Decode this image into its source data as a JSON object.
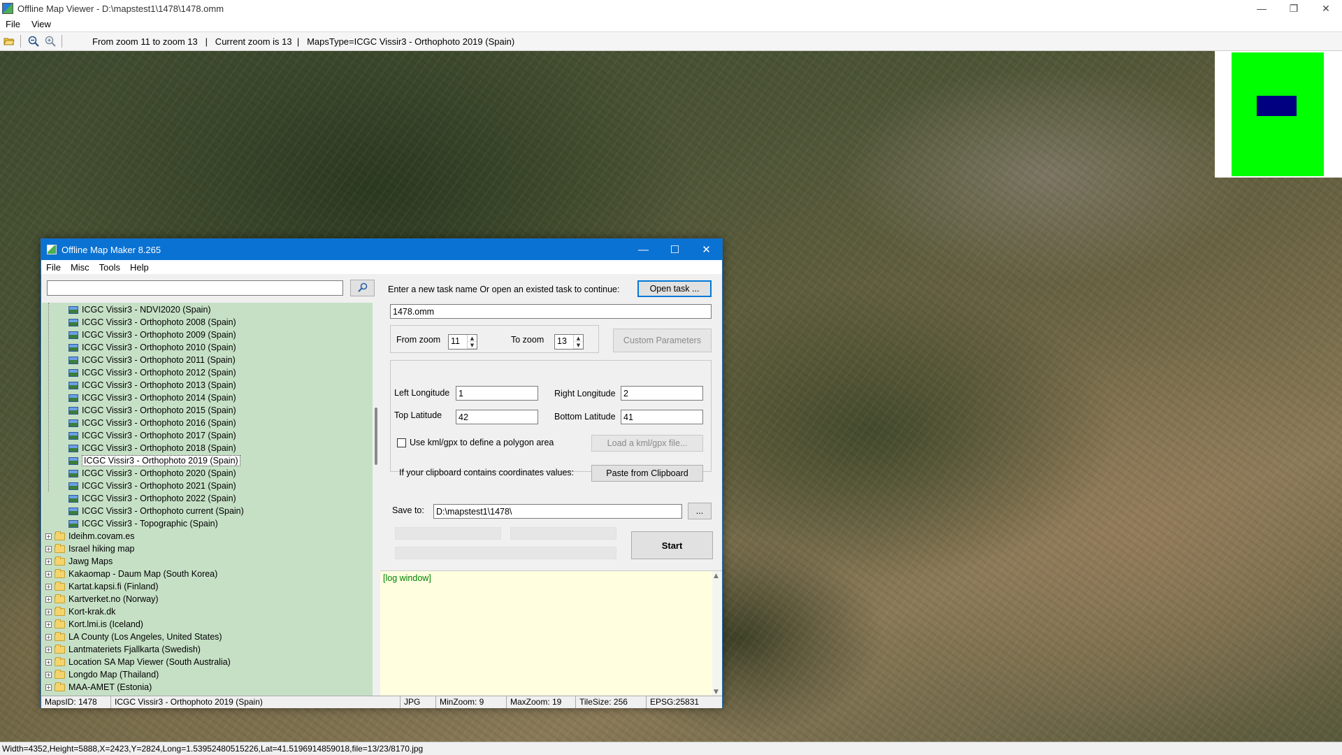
{
  "viewer": {
    "title": "Offline Map Viewer - D:\\mapstest1\\1478\\1478.omm",
    "menu": [
      "File",
      "View"
    ],
    "toolbar_status": "From zoom 11 to zoom 13   |   Current zoom is 13  |   MapsType=ICGC Vissir3 - Orthophoto 2019 (Spain)",
    "statusbar": "Width=4352,Height=5888,X=2423,Y=2824,Long=1.53952480515226,Lat=41.5196914859018,file=13/23/8170.jpg",
    "colors": {
      "minimap_area": "#00ff00",
      "minimap_box": "#000080"
    }
  },
  "dialog": {
    "title": "Offline Map Maker 8.265",
    "menu": [
      "File",
      "Misc",
      "Tools",
      "Help"
    ],
    "search": {
      "value": "",
      "placeholder": ""
    },
    "tree": {
      "children": [
        "ICGC Vissir3 - NDVI2020 (Spain)",
        "ICGC Vissir3 - Orthophoto 2008 (Spain)",
        "ICGC Vissir3 - Orthophoto 2009 (Spain)",
        "ICGC Vissir3 - Orthophoto 2010 (Spain)",
        "ICGC Vissir3 - Orthophoto 2011 (Spain)",
        "ICGC Vissir3 - Orthophoto 2012 (Spain)",
        "ICGC Vissir3 - Orthophoto 2013 (Spain)",
        "ICGC Vissir3 - Orthophoto 2014 (Spain)",
        "ICGC Vissir3 - Orthophoto 2015 (Spain)",
        "ICGC Vissir3 - Orthophoto 2016 (Spain)",
        "ICGC Vissir3 - Orthophoto 2017 (Spain)",
        "ICGC Vissir3 - Orthophoto 2018 (Spain)",
        "ICGC Vissir3 - Orthophoto 2019 (Spain)",
        "ICGC Vissir3 - Orthophoto 2020 (Spain)",
        "ICGC Vissir3 - Orthophoto 2021 (Spain)",
        "ICGC Vissir3 - Orthophoto 2022 (Spain)",
        "ICGC Vissir3 - Orthophoto current (Spain)",
        "ICGC Vissir3 - Topographic (Spain)"
      ],
      "selected": "ICGC Vissir3 - Orthophoto 2019 (Spain)",
      "folders": [
        "Ideihm.covam.es",
        "Israel hiking map",
        "Jawg Maps",
        "Kakaomap - Daum Map (South Korea)",
        "Kartat.kapsi.fi (Finland)",
        "Kartverket.no (Norway)",
        "Kort-krak.dk",
        "Kort.lmi.is (Iceland)",
        "LA County (Los Angeles, United States)",
        "Lantmateriets Fjallkarta (Swedish)",
        "Location SA Map Viewer (South Australia)",
        "Longdo Map (Thailand)",
        "MAA-AMET (Estonia)"
      ]
    },
    "task_prompt": "Enter a new task name Or open an existed task to continue:",
    "open_task_label": "Open task ...",
    "task_name": "1478.omm",
    "from_zoom_label": "From zoom",
    "from_zoom": "11",
    "to_zoom_label": "To zoom",
    "to_zoom": "13",
    "custom_params_label": "Custom Parameters",
    "left_lon_label": "Left Longitude",
    "left_lon": "1",
    "right_lon_label": "Right Longitude",
    "right_lon": "2",
    "top_lat_label": "Top Latitude",
    "top_lat": "42",
    "bottom_lat_label": "Bottom Latitude",
    "bottom_lat": "41",
    "kml_label": "Use kml/gpx to define a polygon area",
    "load_kml_label": "Load a kml/gpx file...",
    "clipboard_prompt": "If your clipboard contains coordinates values:",
    "paste_label": "Paste from Clipboard",
    "save_to_label": "Save to:",
    "save_to": "D:\\mapstest1\\1478\\",
    "browse_label": "...",
    "start_label": "Start",
    "log_text": "[log window]",
    "status": {
      "maps_id": "MapsID: 1478",
      "map_name": "ICGC Vissir3 - Orthophoto 2019 (Spain)",
      "format": "JPG",
      "min_zoom": "MinZoom: 9",
      "max_zoom": "MaxZoom: 19",
      "tile_size": "TileSize: 256",
      "epsg": "EPSG:25831"
    }
  }
}
